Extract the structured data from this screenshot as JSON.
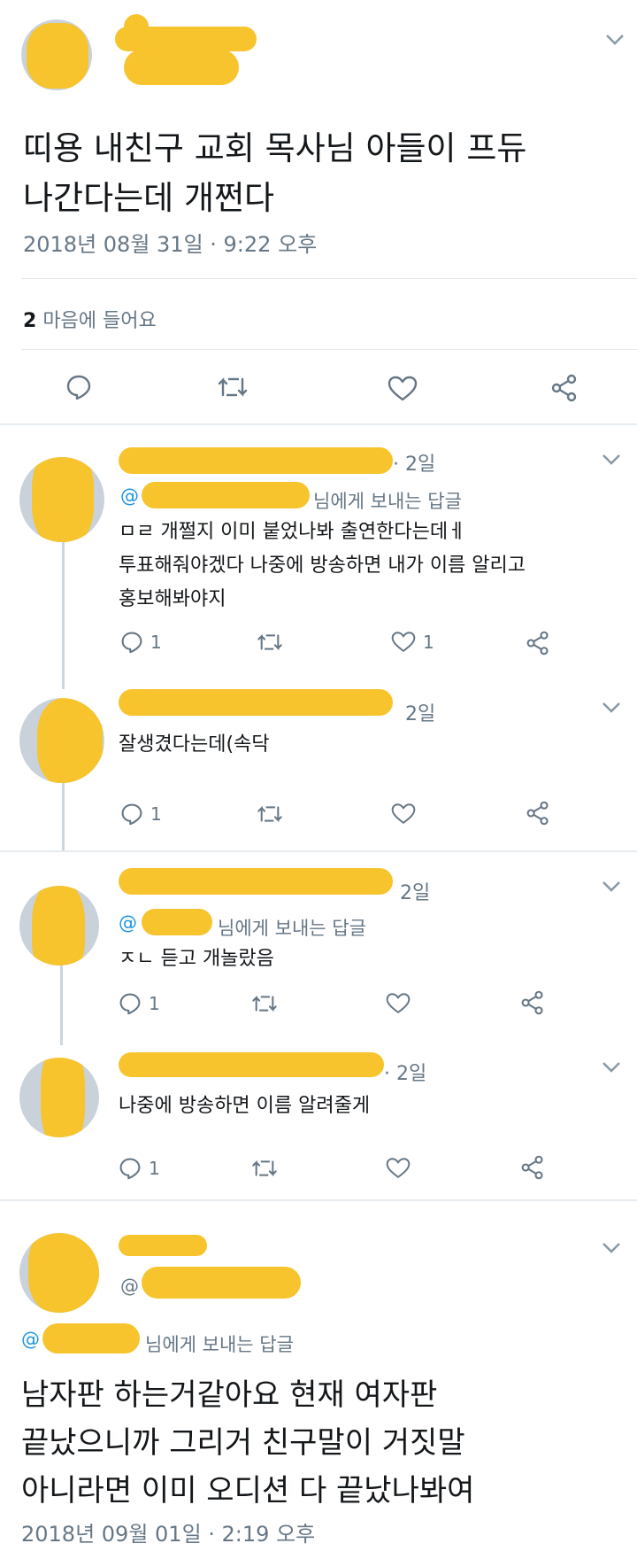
{
  "main_tweet": {
    "text_line1": "띠용 내친구 교회 목사님 아들이 프듀",
    "text_line2": "나간다는데 개쩐다",
    "timestamp": "2018년 08월 31일 · 9:22 오후",
    "likes_count": "2",
    "likes_label": "마음에 들어요"
  },
  "replies": [
    {
      "time": "· 2일",
      "replying_prefix": "@",
      "replying_suffix": "님에게 보내는 답글",
      "text_lines": [
        "ㅁㄹ 개쩔지 이미 붙었나봐 출연한다는데ㅔ",
        "투표해줘야겠다 나중에 방송하면 내가 이름 알리고",
        "홍보해봐야지"
      ],
      "reply_count": "1",
      "like_count": "1"
    },
    {
      "time": "2일",
      "text_lines": [
        "잘생겼다는데(속닥"
      ],
      "reply_count": "1"
    },
    {
      "time": "2일",
      "replying_prefix": "@",
      "replying_suffix": "님에게 보내는 답글",
      "text_lines": [
        "ㅈㄴ 듣고 개놀랐음"
      ],
      "reply_count": "1"
    },
    {
      "time": "· 2일",
      "text_lines": [
        "나중에 방송하면 이름 알려줄게"
      ],
      "reply_count": "1"
    }
  ],
  "last_tweet": {
    "handle_prefix": "@",
    "replying_prefix": "@",
    "replying_suffix": "님에게 보내는 답글",
    "text_line1": "남자판 하는거같아요 현재 여자판",
    "text_line2": "끝났으니까 그리거 친구말이 거짓말",
    "text_line3": "아니라면 이미 오디션 다 끝났나봐여",
    "timestamp": "2018년 09월 01일 · 2:19 오후"
  },
  "colors": {
    "accent": "#1b95e0",
    "muted": "#657786",
    "redaction": "#f7c42e",
    "divider": "#e1e8ed"
  },
  "icons": [
    "reply-icon",
    "retweet-icon",
    "like-icon",
    "share-icon",
    "chevron-down-icon"
  ]
}
